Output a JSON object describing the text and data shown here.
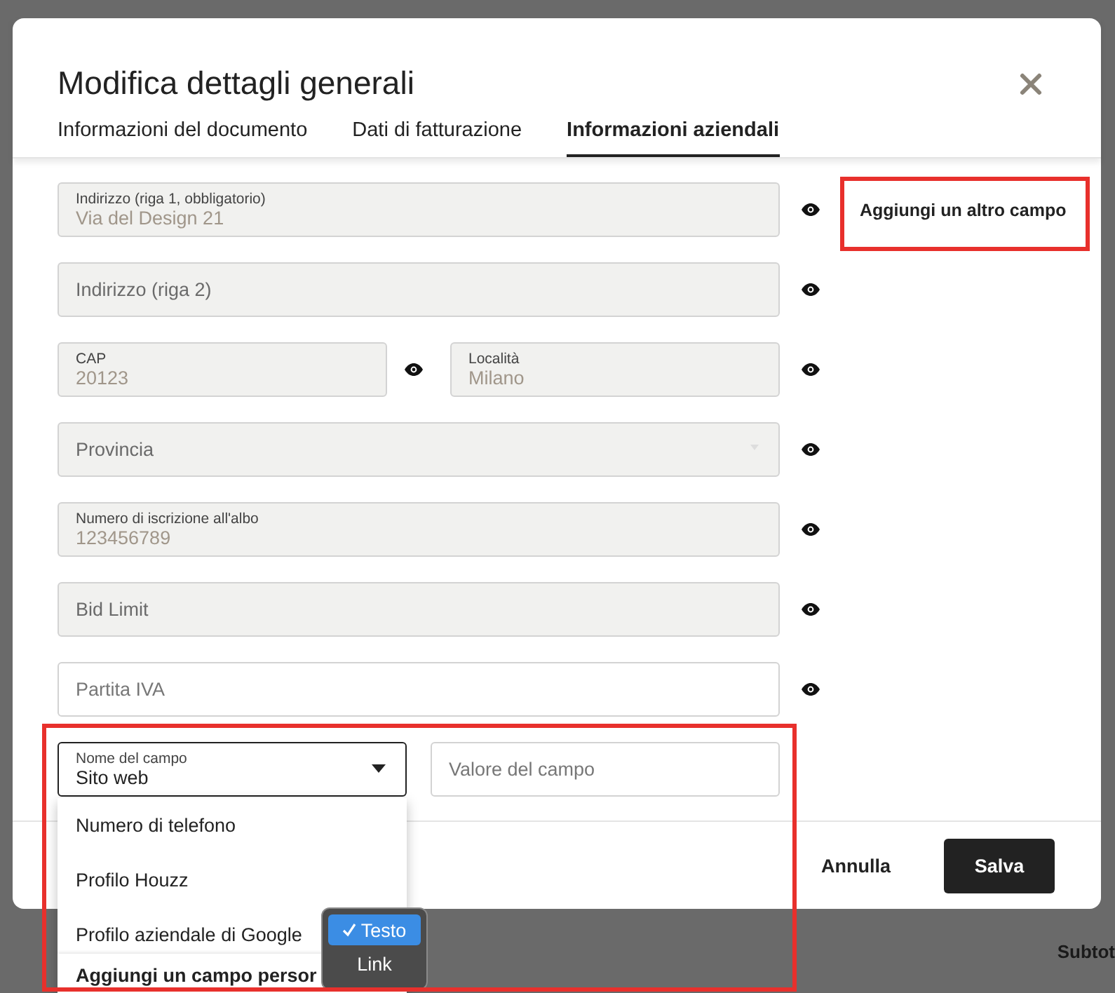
{
  "background_text": "Subtot",
  "dialog": {
    "title": "Modifica dettagli generali",
    "tabs": [
      {
        "label": "Informazioni del documento",
        "selected": false
      },
      {
        "label": "Dati di fatturazione",
        "selected": false
      },
      {
        "label": "Informazioni aziendali",
        "selected": true
      }
    ],
    "rows": [
      [
        {
          "kind": "input",
          "label": "Indirizzo (riga 1, obbligatorio)",
          "value": "Via del Design 21",
          "disabled": true
        }
      ],
      [
        {
          "kind": "input",
          "placeholder": "Indirizzo (riga 2)",
          "disabled": true
        }
      ],
      [
        {
          "kind": "input",
          "label": "CAP",
          "value": "20123",
          "disabled": true
        },
        {
          "kind": "input",
          "label": "Località",
          "value": "Milano",
          "disabled": true
        }
      ],
      [
        {
          "kind": "select",
          "placeholder": "Provincia",
          "disabled": true
        }
      ],
      [
        {
          "kind": "input",
          "label": "Numero di iscrizione all'albo",
          "value": "123456789",
          "disabled": true
        }
      ],
      [
        {
          "kind": "input",
          "placeholder": "Bid Limit",
          "disabled": true
        }
      ],
      [
        {
          "kind": "input",
          "placeholder": "Partita IVA",
          "disabled": false
        }
      ]
    ],
    "add_field_button": "Aggiungi un altro campo",
    "custom_field": {
      "name_label": "Nome del campo",
      "name_value": "Sito web",
      "value_placeholder": "Valore del campo",
      "options": [
        "Numero di telefono",
        "Profilo Houzz",
        "Profilo aziendale di Google"
      ],
      "footer_option": "Aggiungi un campo persor",
      "type_menu": [
        {
          "label": "Testo",
          "selected": true
        },
        {
          "label": "Link",
          "selected": false
        }
      ]
    },
    "cancel_button": "Annulla",
    "save_button": "Salva"
  }
}
